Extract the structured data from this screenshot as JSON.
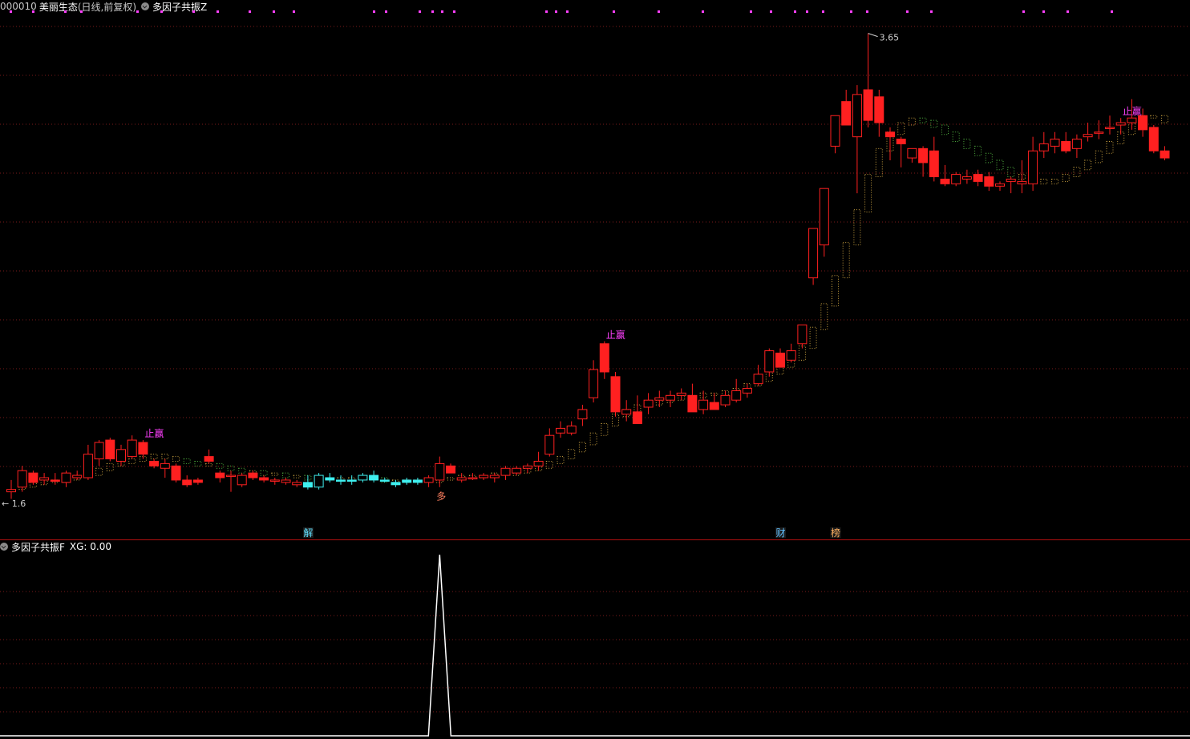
{
  "header": {
    "stock_code": "000010",
    "stock_name": "美丽生态",
    "period_label": "(日线,前复权)",
    "main_indicator": "多因子共振Z"
  },
  "sub_panel": {
    "indicator": "多因子共振F",
    "value_label": "XG: 0.00"
  },
  "colors": {
    "background": "#000000",
    "up_candle": "#ff2020",
    "down_candle": "#ff2020",
    "cyan_candle": "#3ff0f0",
    "grid": "#7a1a1a",
    "divider": "#b01010",
    "ladder_up": "#c8a040",
    "ladder_down": "#50b040",
    "signal_text": "#ff40ff",
    "dot_marker": "#ff40ff",
    "xg_line": "#ffffff"
  },
  "chart_data": [
    {
      "type": "candlestick",
      "title": "000010 美丽生态(日线,前复权)",
      "price_range": [
        1.6,
        3.7
      ],
      "grid": true,
      "annotations": {
        "max_label": "3.65",
        "min_label": "1.6",
        "signals": [
          {
            "text": "止赢",
            "index": 12
          },
          {
            "text": "止赢",
            "index": 54
          },
          {
            "text": "止赢",
            "index": 101
          },
          {
            "text": "多",
            "index": 39
          }
        ],
        "events": [
          {
            "text": "解",
            "index": 27
          },
          {
            "text": "财",
            "index": 70
          },
          {
            "text": "榜",
            "index": 75
          }
        ]
      },
      "candles": [
        {
          "o": 1.69,
          "h": 1.74,
          "l": 1.66,
          "c": 1.7,
          "k": "u"
        },
        {
          "o": 1.71,
          "h": 1.8,
          "l": 1.69,
          "c": 1.78,
          "k": "u"
        },
        {
          "o": 1.77,
          "h": 1.78,
          "l": 1.72,
          "c": 1.73,
          "k": "d"
        },
        {
          "o": 1.74,
          "h": 1.77,
          "l": 1.72,
          "c": 1.75,
          "k": "u"
        },
        {
          "o": 1.74,
          "h": 1.77,
          "l": 1.72,
          "c": 1.74,
          "k": "d"
        },
        {
          "o": 1.73,
          "h": 1.78,
          "l": 1.71,
          "c": 1.77,
          "k": "u"
        },
        {
          "o": 1.75,
          "h": 1.78,
          "l": 1.74,
          "c": 1.76,
          "k": "u"
        },
        {
          "o": 1.75,
          "h": 1.89,
          "l": 1.74,
          "c": 1.85,
          "k": "u"
        },
        {
          "o": 1.83,
          "h": 1.91,
          "l": 1.8,
          "c": 1.9,
          "k": "u"
        },
        {
          "o": 1.91,
          "h": 1.92,
          "l": 1.82,
          "c": 1.83,
          "k": "d"
        },
        {
          "o": 1.82,
          "h": 1.89,
          "l": 1.8,
          "c": 1.87,
          "k": "u"
        },
        {
          "o": 1.84,
          "h": 1.93,
          "l": 1.83,
          "c": 1.91,
          "k": "u"
        },
        {
          "o": 1.9,
          "h": 1.91,
          "l": 1.83,
          "c": 1.85,
          "k": "d"
        },
        {
          "o": 1.82,
          "h": 1.83,
          "l": 1.79,
          "c": 1.8,
          "k": "d"
        },
        {
          "o": 1.81,
          "h": 1.83,
          "l": 1.75,
          "c": 1.79,
          "k": "u"
        },
        {
          "o": 1.8,
          "h": 1.81,
          "l": 1.73,
          "c": 1.74,
          "k": "d"
        },
        {
          "o": 1.74,
          "h": 1.76,
          "l": 1.71,
          "c": 1.72,
          "k": "d"
        },
        {
          "o": 1.74,
          "h": 1.75,
          "l": 1.72,
          "c": 1.73,
          "k": "d"
        },
        {
          "o": 1.84,
          "h": 1.87,
          "l": 1.81,
          "c": 1.82,
          "k": "d"
        },
        {
          "o": 1.77,
          "h": 1.78,
          "l": 1.73,
          "c": 1.75,
          "k": "d"
        },
        {
          "o": 1.76,
          "h": 1.78,
          "l": 1.69,
          "c": 1.76,
          "k": "u"
        },
        {
          "o": 1.72,
          "h": 1.77,
          "l": 1.71,
          "c": 1.76,
          "k": "u"
        },
        {
          "o": 1.77,
          "h": 1.78,
          "l": 1.74,
          "c": 1.75,
          "k": "d"
        },
        {
          "o": 1.75,
          "h": 1.76,
          "l": 1.73,
          "c": 1.74,
          "k": "d"
        },
        {
          "o": 1.74,
          "h": 1.75,
          "l": 1.72,
          "c": 1.74,
          "k": "u"
        },
        {
          "o": 1.74,
          "h": 1.75,
          "l": 1.72,
          "c": 1.73,
          "k": "u"
        },
        {
          "o": 1.73,
          "h": 1.74,
          "l": 1.71,
          "c": 1.72,
          "k": "u"
        },
        {
          "o": 1.73,
          "h": 1.76,
          "l": 1.7,
          "c": 1.71,
          "k": "c"
        },
        {
          "o": 1.71,
          "h": 1.77,
          "l": 1.7,
          "c": 1.76,
          "k": "co"
        },
        {
          "o": 1.74,
          "h": 1.77,
          "l": 1.73,
          "c": 1.75,
          "k": "c"
        },
        {
          "o": 1.74,
          "h": 1.76,
          "l": 1.72,
          "c": 1.74,
          "k": "c"
        },
        {
          "o": 1.74,
          "h": 1.76,
          "l": 1.72,
          "c": 1.74,
          "k": "c"
        },
        {
          "o": 1.74,
          "h": 1.77,
          "l": 1.73,
          "c": 1.76,
          "k": "co"
        },
        {
          "o": 1.76,
          "h": 1.78,
          "l": 1.73,
          "c": 1.74,
          "k": "c"
        },
        {
          "o": 1.74,
          "h": 1.75,
          "l": 1.73,
          "c": 1.74,
          "k": "c"
        },
        {
          "o": 1.73,
          "h": 1.74,
          "l": 1.71,
          "c": 1.72,
          "k": "c"
        },
        {
          "o": 1.73,
          "h": 1.75,
          "l": 1.72,
          "c": 1.74,
          "k": "c"
        },
        {
          "o": 1.74,
          "h": 1.75,
          "l": 1.72,
          "c": 1.73,
          "k": "c"
        },
        {
          "o": 1.73,
          "h": 1.76,
          "l": 1.71,
          "c": 1.75,
          "k": "u"
        },
        {
          "o": 1.74,
          "h": 1.84,
          "l": 1.71,
          "c": 1.81,
          "k": "u"
        },
        {
          "o": 1.8,
          "h": 1.81,
          "l": 1.77,
          "c": 1.77,
          "k": "d"
        },
        {
          "o": 1.75,
          "h": 1.77,
          "l": 1.73,
          "c": 1.74,
          "k": "u"
        },
        {
          "o": 1.75,
          "h": 1.77,
          "l": 1.74,
          "c": 1.75,
          "k": "u"
        },
        {
          "o": 1.75,
          "h": 1.77,
          "l": 1.74,
          "c": 1.76,
          "k": "u"
        },
        {
          "o": 1.75,
          "h": 1.77,
          "l": 1.73,
          "c": 1.76,
          "k": "u"
        },
        {
          "o": 1.76,
          "h": 1.8,
          "l": 1.74,
          "c": 1.79,
          "k": "u"
        },
        {
          "o": 1.77,
          "h": 1.8,
          "l": 1.76,
          "c": 1.79,
          "k": "u"
        },
        {
          "o": 1.79,
          "h": 1.81,
          "l": 1.77,
          "c": 1.8,
          "k": "u"
        },
        {
          "o": 1.8,
          "h": 1.86,
          "l": 1.78,
          "c": 1.82,
          "k": "u"
        },
        {
          "o": 1.85,
          "h": 1.96,
          "l": 1.84,
          "c": 1.93,
          "k": "u"
        },
        {
          "o": 1.94,
          "h": 1.99,
          "l": 1.92,
          "c": 1.96,
          "k": "u"
        },
        {
          "o": 1.94,
          "h": 1.99,
          "l": 1.93,
          "c": 1.97,
          "k": "u"
        },
        {
          "o": 2.0,
          "h": 2.06,
          "l": 1.97,
          "c": 2.04,
          "k": "u"
        },
        {
          "o": 2.09,
          "h": 2.25,
          "l": 2.07,
          "c": 2.21,
          "k": "u"
        },
        {
          "o": 2.32,
          "h": 2.33,
          "l": 2.17,
          "c": 2.2,
          "k": "d"
        },
        {
          "o": 2.18,
          "h": 2.2,
          "l": 2.01,
          "c": 2.03,
          "k": "d"
        },
        {
          "o": 2.04,
          "h": 2.08,
          "l": 1.99,
          "c": 2.02,
          "k": "u"
        },
        {
          "o": 2.03,
          "h": 2.1,
          "l": 1.99,
          "c": 1.98,
          "k": "d"
        },
        {
          "o": 2.05,
          "h": 2.11,
          "l": 2.02,
          "c": 2.08,
          "k": "u"
        },
        {
          "o": 2.08,
          "h": 2.12,
          "l": 2.05,
          "c": 2.09,
          "k": "u"
        },
        {
          "o": 2.08,
          "h": 2.12,
          "l": 2.05,
          "c": 2.1,
          "k": "u"
        },
        {
          "o": 2.1,
          "h": 2.13,
          "l": 2.08,
          "c": 2.11,
          "k": "u"
        },
        {
          "o": 2.1,
          "h": 2.15,
          "l": 2.07,
          "c": 2.03,
          "k": "d"
        },
        {
          "o": 2.04,
          "h": 2.12,
          "l": 2.02,
          "c": 2.08,
          "k": "u"
        },
        {
          "o": 2.07,
          "h": 2.11,
          "l": 2.04,
          "c": 2.04,
          "k": "d"
        },
        {
          "o": 2.06,
          "h": 2.12,
          "l": 2.05,
          "c": 2.1,
          "k": "u"
        },
        {
          "o": 2.08,
          "h": 2.17,
          "l": 2.07,
          "c": 2.12,
          "k": "u"
        },
        {
          "o": 2.11,
          "h": 2.15,
          "l": 2.09,
          "c": 2.13,
          "k": "u"
        },
        {
          "o": 2.15,
          "h": 2.23,
          "l": 2.14,
          "c": 2.19,
          "k": "u"
        },
        {
          "o": 2.2,
          "h": 2.3,
          "l": 2.18,
          "c": 2.29,
          "k": "u"
        },
        {
          "o": 2.28,
          "h": 2.3,
          "l": 2.22,
          "c": 2.22,
          "k": "d"
        },
        {
          "o": 2.25,
          "h": 2.32,
          "l": 2.24,
          "c": 2.29,
          "k": "u"
        },
        {
          "o": 2.32,
          "h": 2.38,
          "l": 2.3,
          "c": 2.4,
          "k": "u"
        },
        {
          "o": 2.6,
          "h": 2.73,
          "l": 2.57,
          "c": 2.81,
          "k": "u"
        },
        {
          "o": 2.74,
          "h": 2.93,
          "l": 2.69,
          "c": 2.98,
          "k": "u"
        },
        {
          "o": 3.16,
          "h": 3.2,
          "l": 3.13,
          "c": 3.29,
          "k": "u"
        },
        {
          "o": 3.35,
          "h": 3.4,
          "l": 3.31,
          "c": 3.25,
          "k": "d"
        },
        {
          "o": 3.2,
          "h": 3.42,
          "l": 2.96,
          "c": 3.38,
          "k": "u"
        },
        {
          "o": 3.4,
          "h": 3.64,
          "l": 3.24,
          "c": 3.27,
          "k": "d"
        },
        {
          "o": 3.37,
          "h": 3.4,
          "l": 3.2,
          "c": 3.26,
          "k": "d"
        },
        {
          "o": 3.22,
          "h": 3.24,
          "l": 3.1,
          "c": 3.2,
          "k": "d"
        },
        {
          "o": 3.19,
          "h": 3.2,
          "l": 3.07,
          "c": 3.17,
          "k": "d"
        },
        {
          "o": 3.11,
          "h": 3.14,
          "l": 3.09,
          "c": 3.15,
          "k": "u"
        },
        {
          "o": 3.15,
          "h": 3.16,
          "l": 3.03,
          "c": 3.09,
          "k": "d"
        },
        {
          "o": 3.14,
          "h": 3.2,
          "l": 3.01,
          "c": 3.03,
          "k": "d"
        },
        {
          "o": 3.02,
          "h": 3.08,
          "l": 2.99,
          "c": 3.0,
          "k": "d"
        },
        {
          "o": 3.0,
          "h": 3.05,
          "l": 2.99,
          "c": 3.04,
          "k": "u"
        },
        {
          "o": 3.02,
          "h": 3.06,
          "l": 3.0,
          "c": 3.03,
          "k": "u"
        },
        {
          "o": 3.04,
          "h": 3.06,
          "l": 2.99,
          "c": 3.01,
          "k": "d"
        },
        {
          "o": 3.03,
          "h": 3.05,
          "l": 2.97,
          "c": 2.99,
          "k": "d"
        },
        {
          "o": 2.99,
          "h": 3.01,
          "l": 2.97,
          "c": 3.0,
          "k": "u"
        },
        {
          "o": 3.01,
          "h": 3.03,
          "l": 2.96,
          "c": 3.02,
          "k": "u"
        },
        {
          "o": 3.0,
          "h": 3.1,
          "l": 2.96,
          "c": 3.01,
          "k": "u"
        },
        {
          "o": 3.0,
          "h": 3.2,
          "l": 2.97,
          "c": 3.14,
          "k": "u"
        },
        {
          "o": 3.14,
          "h": 3.22,
          "l": 3.11,
          "c": 3.17,
          "k": "u"
        },
        {
          "o": 3.19,
          "h": 3.22,
          "l": 3.13,
          "c": 3.16,
          "k": "u"
        },
        {
          "o": 3.18,
          "h": 3.22,
          "l": 3.13,
          "c": 3.14,
          "k": "d"
        },
        {
          "o": 3.15,
          "h": 3.21,
          "l": 3.11,
          "c": 3.19,
          "k": "u"
        },
        {
          "o": 3.21,
          "h": 3.26,
          "l": 3.18,
          "c": 3.2,
          "k": "u"
        },
        {
          "o": 3.22,
          "h": 3.27,
          "l": 3.19,
          "c": 3.22,
          "k": "u"
        },
        {
          "o": 3.24,
          "h": 3.29,
          "l": 3.21,
          "c": 3.24,
          "k": "u"
        },
        {
          "o": 3.25,
          "h": 3.28,
          "l": 3.21,
          "c": 3.26,
          "k": "u"
        },
        {
          "o": 3.26,
          "h": 3.36,
          "l": 3.23,
          "c": 3.28,
          "k": "u"
        },
        {
          "o": 3.29,
          "h": 3.32,
          "l": 3.2,
          "c": 3.23,
          "k": "d"
        },
        {
          "o": 3.24,
          "h": 3.25,
          "l": 3.13,
          "c": 3.14,
          "k": "d"
        },
        {
          "o": 3.14,
          "h": 3.16,
          "l": 3.1,
          "c": 3.11,
          "k": "d"
        }
      ],
      "ladder": [
        1.7,
        1.71,
        1.72,
        1.73,
        1.73,
        1.74,
        1.75,
        1.76,
        1.78,
        1.8,
        1.81,
        1.82,
        1.83,
        1.84,
        1.83,
        1.82,
        1.81,
        1.8,
        1.8,
        1.79,
        1.78,
        1.77,
        1.77,
        1.76,
        1.76,
        1.75,
        1.75,
        1.74,
        1.74,
        1.74,
        1.74,
        1.74,
        1.74,
        1.74,
        1.73,
        1.73,
        1.73,
        1.73,
        1.73,
        1.74,
        1.74,
        1.75,
        1.75,
        1.75,
        1.76,
        1.76,
        1.77,
        1.78,
        1.79,
        1.81,
        1.83,
        1.86,
        1.89,
        1.93,
        1.97,
        2.01,
        2.03,
        2.05,
        2.06,
        2.07,
        2.08,
        2.09,
        2.09,
        2.1,
        2.1,
        2.11,
        2.12,
        2.14,
        2.16,
        2.19,
        2.22,
        2.25,
        2.3,
        2.38,
        2.48,
        2.6,
        2.74,
        2.88,
        3.03,
        3.14,
        3.21,
        3.25,
        3.27,
        3.26,
        3.24,
        3.21,
        3.18,
        3.15,
        3.12,
        3.09,
        3.06,
        3.03,
        3.02,
        3.01,
        3.0,
        3.01,
        3.03,
        3.06,
        3.09,
        3.13,
        3.17,
        3.21,
        3.25,
        3.28,
        3.28,
        3.26
      ]
    },
    {
      "type": "line",
      "title": "多因子共振F",
      "series": [
        {
          "name": "XG",
          "signal_index": 39,
          "values_note": "0 except 1 at signal"
        }
      ],
      "ylim": [
        0,
        1
      ]
    }
  ]
}
